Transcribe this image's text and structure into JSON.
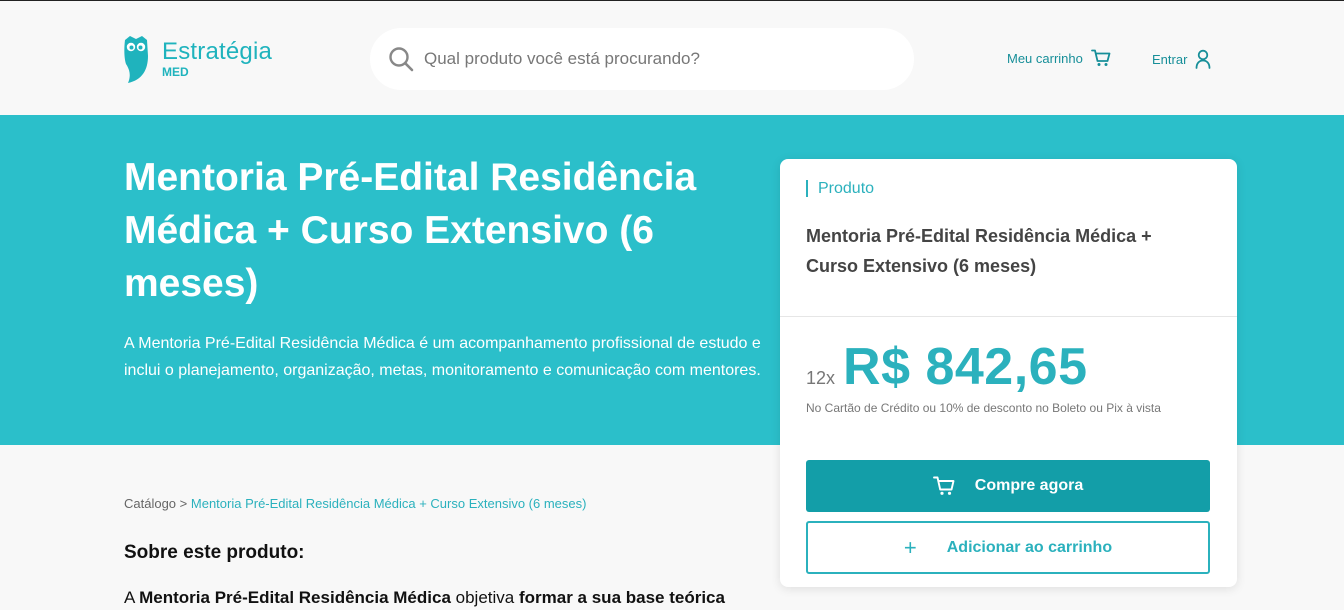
{
  "header": {
    "logo_name": "Estratégia",
    "logo_sub": "MED",
    "search_placeholder": "Qual produto você está procurando?",
    "cart_label": "Meu carrinho",
    "login_label": "Entrar"
  },
  "hero": {
    "title": "Mentoria Pré-Edital Residência Médica + Curso Extensivo (6 meses)",
    "description": "A Mentoria Pré-Edital Residência Médica é um acompanhamento profissional de estudo e inclui o planejamento, organização, metas, monitoramento e comunicação com mentores."
  },
  "breadcrumb": {
    "root": "Catálogo",
    "separator": ">",
    "current": "Mentoria Pré-Edital Residência Médica + Curso Extensivo (6 meses)"
  },
  "about": {
    "title": "Sobre este produto:",
    "text_a": "A",
    "text_bold_1": "Mentoria Pré-Edital Residência Médica",
    "text_b": "objetiva",
    "text_bold_2": "formar a sua base teórica"
  },
  "card": {
    "label": "Produto",
    "name": "Mentoria Pré-Edital Residência Médica + Curso Extensivo (6 meses)",
    "installments": "12x",
    "price": "R$ 842,65",
    "price_note": "No Cartão de Crédito ou 10% de desconto no Boleto ou Pix à vista",
    "buy_label": "Compre agora",
    "add_label": "Adicionar ao carrinho",
    "add_icon": "+"
  },
  "colors": {
    "brand": "#2bbfca",
    "brand_dark": "#139ea8",
    "accent_text": "#2bb1bd"
  },
  "icons": {
    "logo": "owl-logo-icon",
    "search": "search-icon",
    "cart": "cart-icon",
    "user": "user-icon",
    "plus": "plus-icon"
  }
}
